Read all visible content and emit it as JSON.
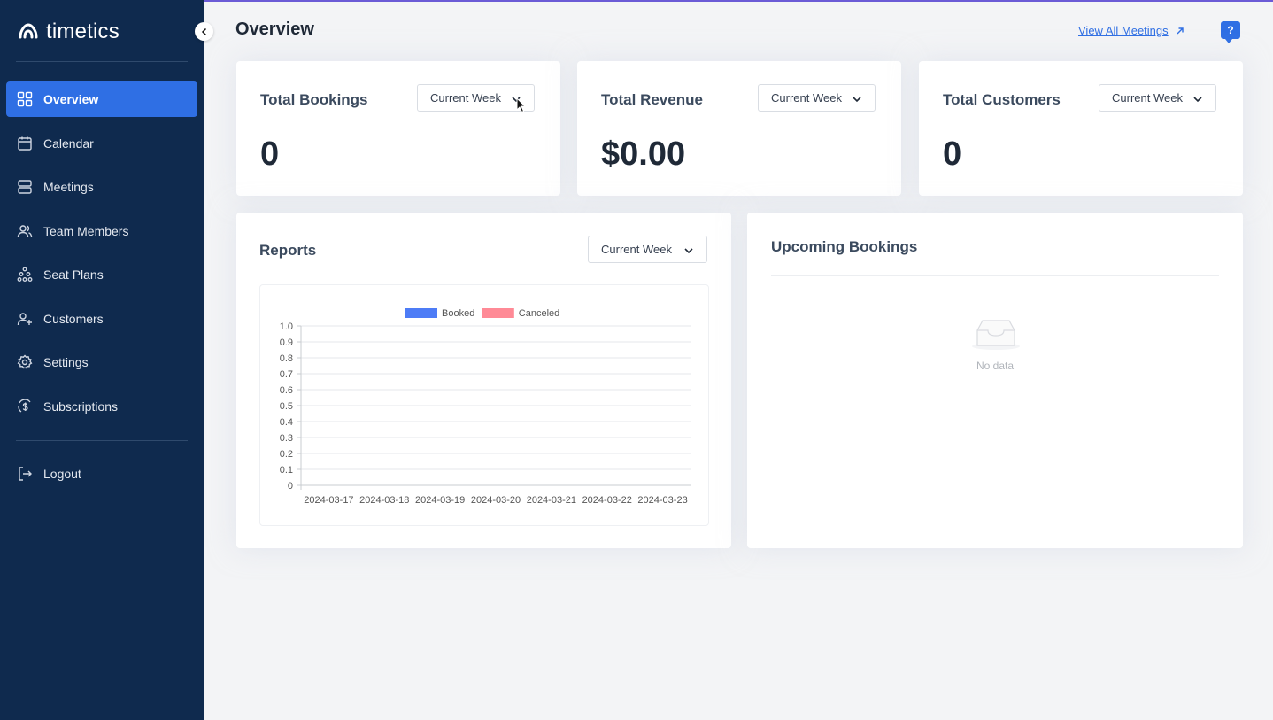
{
  "app": {
    "brand": "timetics",
    "accent": "#2f6fe4",
    "sidebar_bg": "#0f2a4e"
  },
  "sidebar": {
    "items": [
      {
        "label": "Overview",
        "icon": "grid-icon",
        "active": true
      },
      {
        "label": "Calendar",
        "icon": "calendar-icon"
      },
      {
        "label": "Meetings",
        "icon": "meetings-icon"
      },
      {
        "label": "Team Members",
        "icon": "team-icon"
      },
      {
        "label": "Seat Plans",
        "icon": "seat-plans-icon"
      },
      {
        "label": "Customers",
        "icon": "add-user-icon"
      },
      {
        "label": "Settings",
        "icon": "gear-icon"
      },
      {
        "label": "Subscriptions",
        "icon": "subscriptions-icon"
      }
    ],
    "logout": "Logout"
  },
  "header": {
    "title": "Overview",
    "view_all": "View All Meetings",
    "help": "?"
  },
  "stats": [
    {
      "title": "Total Bookings",
      "value": "0",
      "period": "Current Week"
    },
    {
      "title": "Total Revenue",
      "value": "$0.00",
      "period": "Current Week"
    },
    {
      "title": "Total Customers",
      "value": "0",
      "period": "Current Week"
    }
  ],
  "reports": {
    "title": "Reports",
    "period": "Current Week"
  },
  "upcoming": {
    "title": "Upcoming Bookings",
    "empty_text": "No data"
  },
  "chart_data": {
    "type": "bar",
    "categories": [
      "2024-03-17",
      "2024-03-18",
      "2024-03-19",
      "2024-03-20",
      "2024-03-21",
      "2024-03-22",
      "2024-03-23"
    ],
    "series": [
      {
        "name": "Booked",
        "color": "#4d7cf6",
        "values": [
          0,
          0,
          0,
          0,
          0,
          0,
          0
        ]
      },
      {
        "name": "Canceled",
        "color": "#ff8a96",
        "values": [
          0,
          0,
          0,
          0,
          0,
          0,
          0
        ]
      }
    ],
    "ylim": [
      0,
      1.0
    ],
    "yticks": [
      "0",
      "0.1",
      "0.2",
      "0.3",
      "0.4",
      "0.5",
      "0.6",
      "0.7",
      "0.8",
      "0.9",
      "1.0"
    ],
    "legend": "top",
    "grid": true
  }
}
